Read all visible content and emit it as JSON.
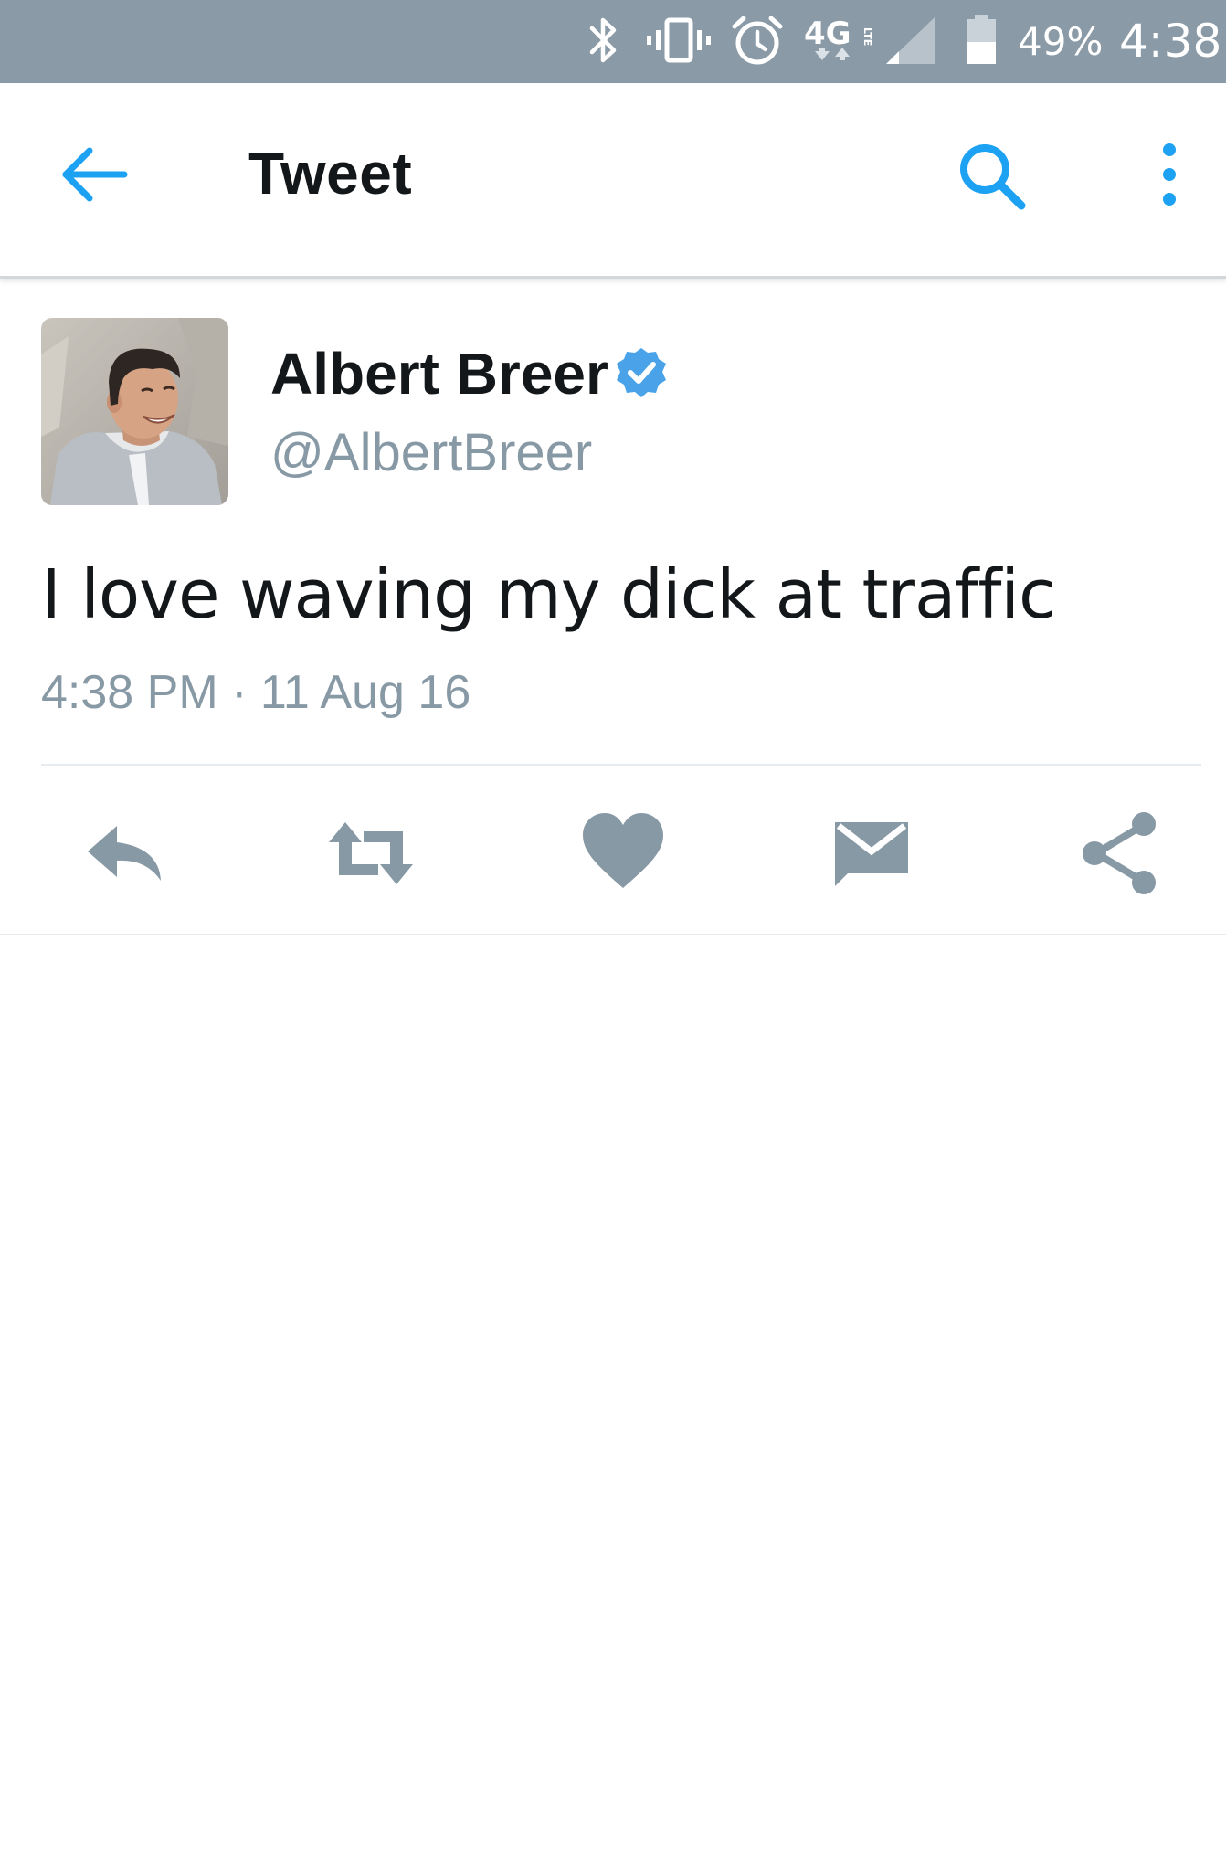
{
  "status_bar": {
    "battery_percent": "49%",
    "time": "4:38",
    "network_label": "4G LTE",
    "icons": [
      "bluetooth-icon",
      "vibrate-icon",
      "alarm-icon",
      "network-4g-lte-icon",
      "signal-icon",
      "battery-icon"
    ],
    "background_color": "#8a9aa6"
  },
  "toolbar": {
    "title": "Tweet",
    "back_icon": "arrow-left-icon",
    "search_icon": "search-icon",
    "more_icon": "more-vertical-icon",
    "accent_color": "#1da1f2"
  },
  "tweet": {
    "author_name": "Albert Breer",
    "author_handle": "@AlbertBreer",
    "verified": true,
    "verified_color": "#4aa3e8",
    "text": "I love waving my dick at traffic",
    "timestamp": "4:38 PM · 11 Aug 16"
  },
  "actions": [
    {
      "name": "reply",
      "icon": "reply-icon"
    },
    {
      "name": "retweet",
      "icon": "retweet-icon"
    },
    {
      "name": "like",
      "icon": "heart-icon"
    },
    {
      "name": "direct-message",
      "icon": "envelope-icon"
    },
    {
      "name": "share",
      "icon": "share-icon"
    }
  ],
  "action_icon_color": "#8899a6"
}
